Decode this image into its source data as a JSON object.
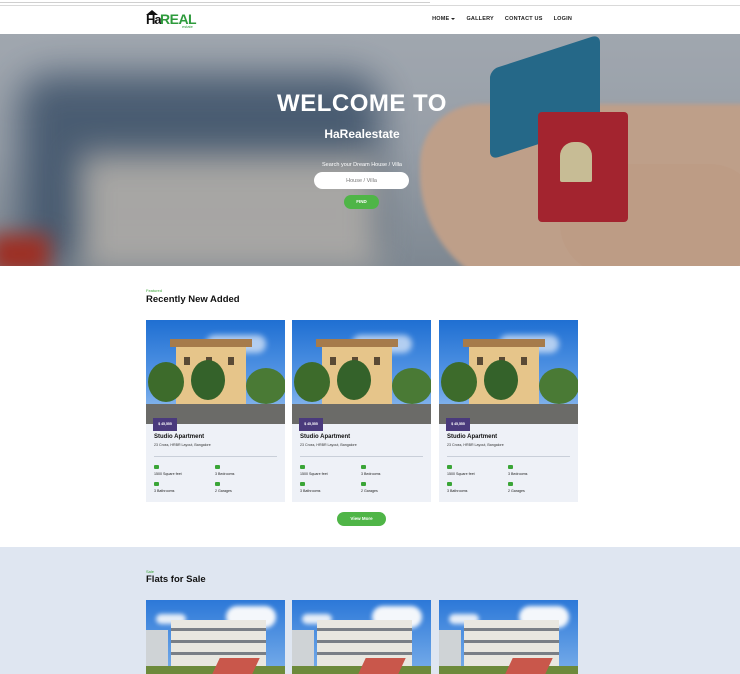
{
  "nav": {
    "logo": {
      "ha": "Ha",
      "real": "REAL",
      "sub": "estate"
    },
    "items": [
      {
        "label": "Home",
        "has_dropdown": true
      },
      {
        "label": "Gallery",
        "has_dropdown": false
      },
      {
        "label": "Contact us",
        "has_dropdown": false
      },
      {
        "label": "Login",
        "has_dropdown": false
      }
    ]
  },
  "hero": {
    "title": "WELCOME TO",
    "subtitle": "HaRealestate",
    "search_label": "Search your Dream House / Villa",
    "search_placeholder": "House / Villa",
    "find_label": "FIND"
  },
  "recent": {
    "eyebrow": "Featured",
    "title": "Recently New Added",
    "cards": [
      {
        "price": "$ 45,555",
        "title": "Studio Apartment",
        "address": "23 Cross, HRBR Layout, Bangalore",
        "area": "1500 Square feet",
        "bedrooms": "3 Bedrooms",
        "bathrooms": "3 Bathrooms",
        "garages": "2 Garages"
      },
      {
        "price": "$ 45,555",
        "title": "Studio Apartment",
        "address": "23 Cross, HRBR Layout, Bangalore",
        "area": "1500 Square feet",
        "bedrooms": "3 Bedrooms",
        "bathrooms": "3 Bathrooms",
        "garages": "2 Garages"
      },
      {
        "price": "$ 45,555",
        "title": "Studio Apartment",
        "address": "23 Cross, HRBR Layout, Bangalore",
        "area": "1500 Square feet",
        "bedrooms": "3 Bedrooms",
        "bathrooms": "3 Bathrooms",
        "garages": "2 Garages"
      }
    ],
    "view_more": "View More"
  },
  "flats": {
    "eyebrow": "Sale",
    "title": "Flats for Sale"
  },
  "colors": {
    "accent_green": "#4fb547",
    "price_badge": "#4a3a7c",
    "flats_bg": "#dfe6f1",
    "card_bg": "#eef1f7"
  }
}
